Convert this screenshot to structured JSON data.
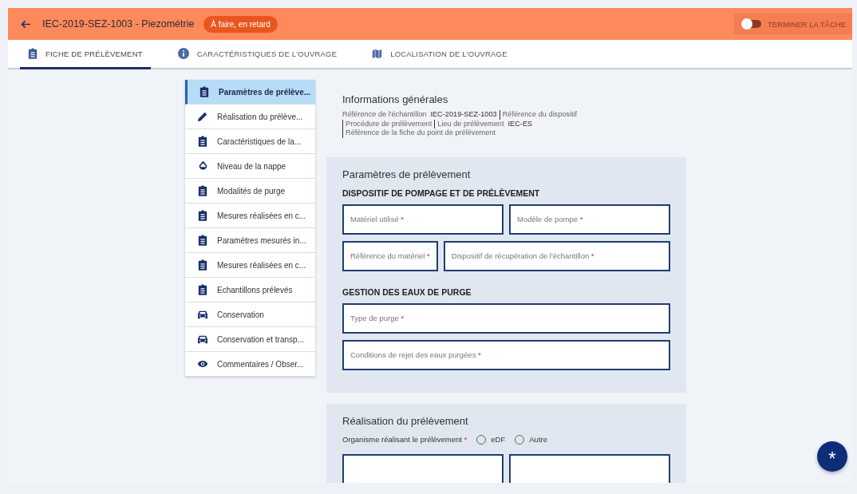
{
  "header": {
    "title": "IEC-2019-SEZ-1003 - Piezométrie",
    "badge": "À faire, en retard",
    "toggle": {
      "label": "TERMINER LA TÂCHE",
      "on": false,
      "disabled": true
    }
  },
  "tabs": [
    {
      "label": "FICHE DE PRÉLÈVEMENT",
      "kind": "clipboard",
      "selected": true
    },
    {
      "label": "CARACTÉRISTIQUES DE L'OUVRAGE",
      "kind": "info",
      "selected": false
    },
    {
      "label": "LOCALISATION DE L'OUVRAGE",
      "kind": "map",
      "selected": false
    }
  ],
  "sidebar": {
    "items": [
      {
        "label": "Paramètres de prélève...",
        "kind": "clipboard",
        "selected": true
      },
      {
        "label": "Réalisation du prélève...",
        "kind": "pencil",
        "selected": false
      },
      {
        "label": "Caractéristiques de la...",
        "kind": "clipboard",
        "selected": false
      },
      {
        "label": "Niveau de la nappe",
        "kind": "drop",
        "selected": false
      },
      {
        "label": "Modalités de purge",
        "kind": "clipboard",
        "selected": false
      },
      {
        "label": "Mesures réalisées en c...",
        "kind": "clipboard",
        "selected": false
      },
      {
        "label": "Paramètres mesurés in...",
        "kind": "clipboard",
        "selected": false
      },
      {
        "label": "Mesures réalisées en c...",
        "kind": "clipboard",
        "selected": false
      },
      {
        "label": "Echantillons prélevés",
        "kind": "clipboard",
        "selected": false
      },
      {
        "label": "Conservation",
        "kind": "car",
        "selected": false
      },
      {
        "label": "Conservation et transp...",
        "kind": "car",
        "selected": false
      },
      {
        "label": "Commentaires / Obser...",
        "kind": "eye",
        "selected": false
      }
    ]
  },
  "info": {
    "title": "Informations générales",
    "items": [
      {
        "label": "Référence de l'échantillon",
        "value": "IEC-2019-SEZ-1003"
      },
      {
        "label": "Référence du dispositif"
      },
      {
        "label": "Procédure de prélèvement"
      },
      {
        "label": "Lieu de prélèvement",
        "value": "IEC-ES"
      },
      {
        "label": "Référence de la fiche du point de prélèvement"
      }
    ]
  },
  "cards": [
    {
      "title": "Paramètres de prélèvement",
      "sections": [
        {
          "heading": "DISPOSITIF DE POMPAGE ET DE PRÉLÈVEMENT",
          "rows": [
            [
              {
                "placeholder": "Matériel utilisé",
                "required_mark": "*"
              },
              {
                "placeholder": "Modèle de pompe",
                "required_mark": "*"
              }
            ],
            [
              {
                "placeholder": "Référence du matériel",
                "required_mark": "*"
              },
              {
                "placeholder": "Dispositif de récupération de l'échantillon",
                "required_mark": "*"
              }
            ]
          ]
        },
        {
          "heading": "GESTION DES EAUX DE PURGE",
          "rows": [
            [
              {
                "placeholder": "Type de purge",
                "required_mark": "*"
              }
            ],
            [
              {
                "placeholder": "Conditions de rejet des eaux purgées",
                "required_mark": "*"
              }
            ]
          ]
        }
      ]
    },
    {
      "title": "Réalisation du prélèvement",
      "radio_group": {
        "label": "Organisme réalisant le prélèvement",
        "required_mark": "*",
        "options": [
          {
            "label": "eDF",
            "selected": false
          },
          {
            "label": "Autre",
            "selected": false
          }
        ]
      },
      "sections": [
        {
          "rows": [
            [
              {},
              {}
            ]
          ]
        }
      ]
    }
  ],
  "fab": {
    "label": "*"
  }
}
